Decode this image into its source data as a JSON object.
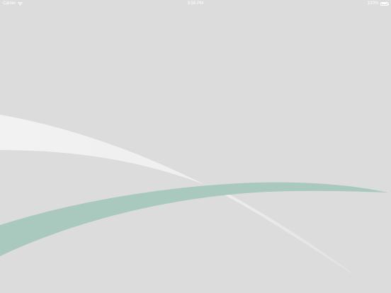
{
  "status_bar": {
    "carrier": "Carrier",
    "time": "9:58 PM",
    "battery_text": "100%",
    "battery_level": 1.0
  },
  "colors": {
    "background": "#dcdcdc",
    "light_swoosh": "#f2f2f2",
    "teal_swoosh": "#a9c9bf",
    "status_text": "#ffffff"
  }
}
